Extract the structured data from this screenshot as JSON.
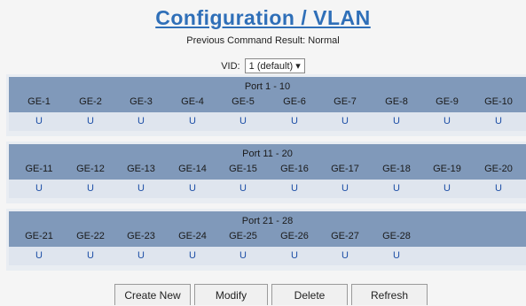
{
  "page": {
    "title": "Configuration / VLAN",
    "command_result_label": "Previous Command Result:",
    "command_result_value": "Normal",
    "vid_label": "VID:",
    "vid_selected": "1 (default) ▾"
  },
  "blocks": [
    {
      "title": "Port 1 - 10",
      "ports": [
        "GE-1",
        "GE-2",
        "GE-3",
        "GE-4",
        "GE-5",
        "GE-6",
        "GE-7",
        "GE-8",
        "GE-9",
        "GE-10"
      ],
      "values": [
        "U",
        "U",
        "U",
        "U",
        "U",
        "U",
        "U",
        "U",
        "U",
        "U"
      ]
    },
    {
      "title": "Port 11 - 20",
      "ports": [
        "GE-11",
        "GE-12",
        "GE-13",
        "GE-14",
        "GE-15",
        "GE-16",
        "GE-17",
        "GE-18",
        "GE-19",
        "GE-20"
      ],
      "values": [
        "U",
        "U",
        "U",
        "U",
        "U",
        "U",
        "U",
        "U",
        "U",
        "U"
      ]
    },
    {
      "title": "Port 21 - 28",
      "ports": [
        "GE-21",
        "GE-22",
        "GE-23",
        "GE-24",
        "GE-25",
        "GE-26",
        "GE-27",
        "GE-28"
      ],
      "values": [
        "U",
        "U",
        "U",
        "U",
        "U",
        "U",
        "U",
        "U"
      ]
    }
  ],
  "buttons": {
    "create_new": "Create New",
    "modify": "Modify",
    "delete": "Delete",
    "refresh": "Refresh"
  }
}
